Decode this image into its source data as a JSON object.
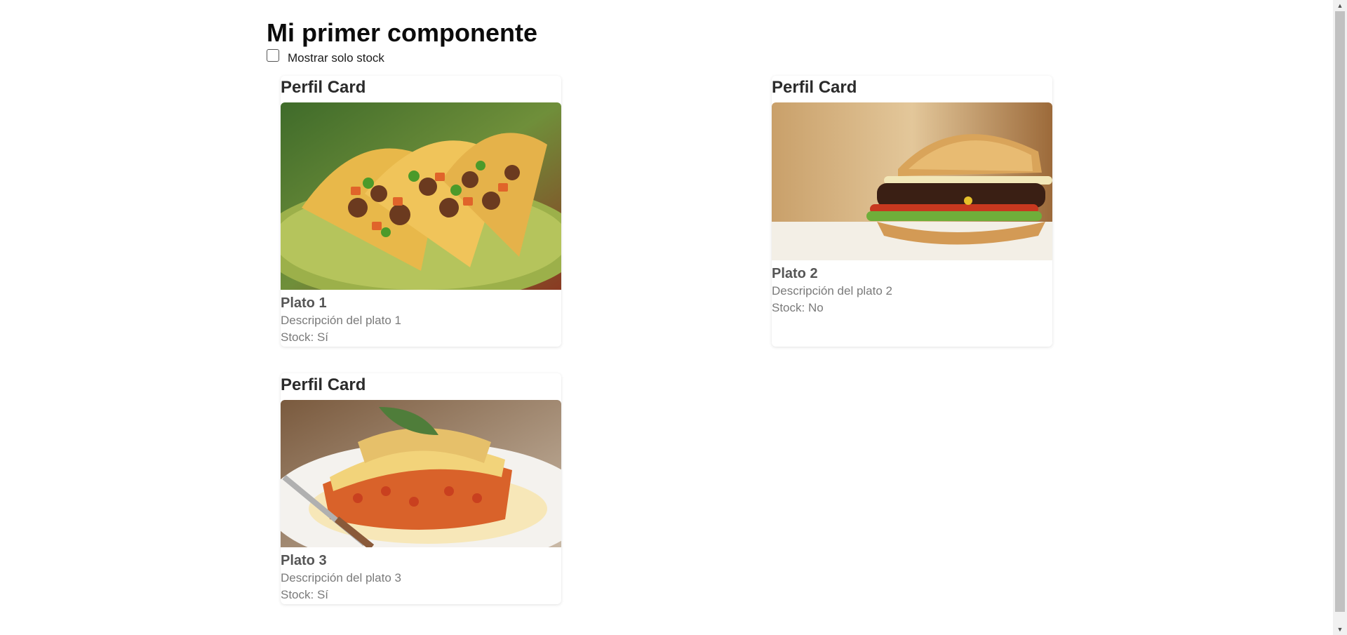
{
  "page": {
    "title": "Mi primer componente",
    "filter": {
      "label": "Mostrar solo stock",
      "checked": false
    }
  },
  "cards": [
    {
      "header": "Perfil Card",
      "image_alt": "tacos",
      "name": "Plato 1",
      "description": "Descripción del plato 1",
      "stock": "Stock: Sí"
    },
    {
      "header": "Perfil Card",
      "image_alt": "hamburguesa",
      "name": "Plato 2",
      "description": "Descripción del plato 2",
      "stock": "Stock: No"
    },
    {
      "header": "Perfil Card",
      "image_alt": "lasaña",
      "name": "Plato 3",
      "description": "Descripción del plato 3",
      "stock": "Stock: Sí"
    }
  ],
  "scrollbar": {
    "up_icon": "triangle-up-icon",
    "down_icon": "triangle-down-icon"
  }
}
